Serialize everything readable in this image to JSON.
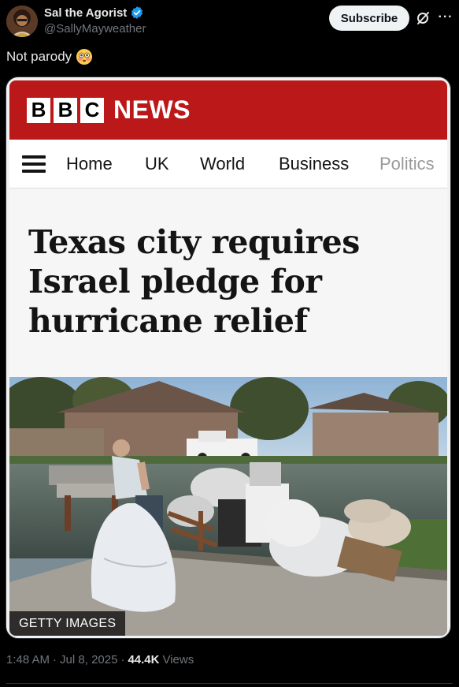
{
  "author": {
    "display_name": "Sal the Agorist",
    "handle": "@SallyMayweather",
    "verified": true
  },
  "actions": {
    "subscribe_label": "Subscribe",
    "grok_icon": "grok-icon",
    "more_icon": "more-icon"
  },
  "tweet": {
    "text": "Not parody",
    "emoji": "flushed-face"
  },
  "embed": {
    "brand_letters": [
      "B",
      "B",
      "C"
    ],
    "brand_word": "NEWS",
    "nav_items": [
      "Home",
      "UK",
      "World",
      "Business",
      "Politics"
    ],
    "headline": "Texas city requires Israel pledge for hurricane relief",
    "photo_credit": "GETTY IMAGES"
  },
  "meta": {
    "time": "1:48 AM",
    "date": "Jul 8, 2025",
    "views_count": "44.4K",
    "views_label": "Views"
  },
  "colors": {
    "background": "#000000",
    "bbc_red": "#bb1919",
    "verified_blue": "#1d9bf0",
    "subscribe_bg": "#eff3f4",
    "secondary_text": "#71767b"
  }
}
